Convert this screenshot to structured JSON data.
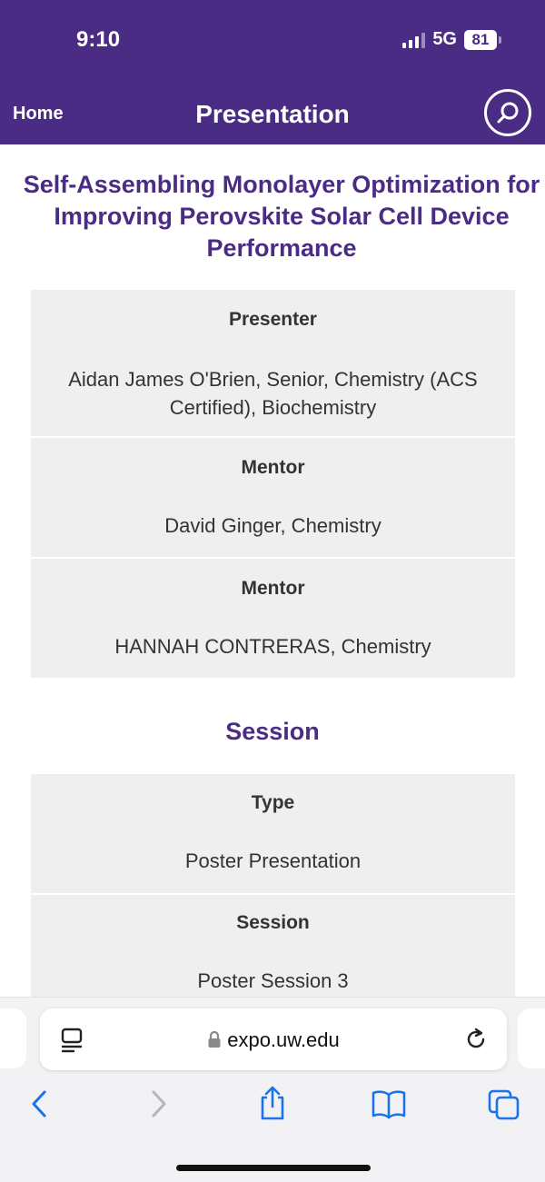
{
  "status": {
    "time": "9:10",
    "network": "5G",
    "battery": "81"
  },
  "header": {
    "home_label": "Home",
    "title": "Presentation"
  },
  "presentation": {
    "title": "Self-Assembling Monolayer Optimization for Improving Perovskite Solar Cell Device Performance"
  },
  "people": [
    {
      "label": "Presenter",
      "value": "Aidan James O'Brien, Senior, Chemistry (ACS Certified), Biochemistry"
    },
    {
      "label": "Mentor",
      "value": "David Ginger, Chemistry"
    },
    {
      "label": "Mentor",
      "value": "HANNAH CONTRERAS, Chemistry"
    }
  ],
  "session": {
    "heading": "Session",
    "rows": [
      {
        "label": "Type",
        "value": "Poster Presentation"
      },
      {
        "label": "Session",
        "value": "Poster Session 3"
      }
    ]
  },
  "browser": {
    "url": "expo.uw.edu"
  },
  "colors": {
    "brand": "#4b2c85",
    "card": "#efefef",
    "link": "#1a73e8"
  },
  "icons": [
    "search-icon",
    "reader-icon",
    "lock-icon",
    "reload-icon",
    "back-icon",
    "forward-icon",
    "share-icon",
    "bookmarks-icon",
    "tabs-icon"
  ]
}
